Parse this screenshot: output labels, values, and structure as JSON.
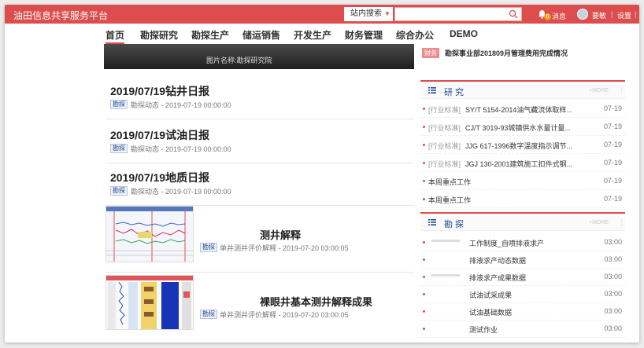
{
  "topbar": {
    "site_title": "油田信息共享服务平台",
    "search_scope": "站内搜索",
    "search_placeholder": "",
    "message_count": "0",
    "message_label": "消息",
    "username": "要敏",
    "settings_label": "设置",
    "separator": "|",
    "accent_color": "#de4d4d"
  },
  "nav": {
    "items": [
      "首页",
      "勘探研究",
      "勘探生产",
      "储运销售",
      "开发生产",
      "财务管理",
      "综合办公",
      "DEMO"
    ]
  },
  "banner": {
    "caption": "图片名称:勘探研究院"
  },
  "posts": [
    {
      "title": "2019/07/19钻井日报",
      "tag": "勘探",
      "meta": "勘探动态 - 2019-07-19 00:00:00"
    },
    {
      "title": "2019/07/19试油日报",
      "tag": "勘探",
      "meta": "勘探动态 - 2019-07-19 00:00:00"
    },
    {
      "title": "2019/07/19地质日报",
      "tag": "勘探",
      "meta": "勘探动态 - 2019-07-19 00:00:00"
    }
  ],
  "image_posts": [
    {
      "title": "测井解释",
      "tag": "勘探",
      "meta": "单井测井评价解释 - 2019-07-20 03:00:05"
    },
    {
      "title": "裸眼井基本测井解释成果",
      "tag": "勘探",
      "meta": "单井测井评价解释 - 2019-07-20 03:00:05"
    }
  ],
  "notice": {
    "badge": "财务",
    "text": "勘探事业部201809月管理费用完成情况"
  },
  "research_panel": {
    "title": "研 究",
    "more": "+MORE",
    "menu": "⋮",
    "rows": [
      {
        "category": "[行业标准]",
        "title": "SY/T 5154-2014油气藏流体取样...",
        "date": "07-19"
      },
      {
        "category": "[行业标准]",
        "title": "CJ/T 3019-93城镇供水水量计量...",
        "date": "07-19"
      },
      {
        "category": "[行业标准]",
        "title": "JJG 617-1996数字温度指示调节...",
        "date": "07-19"
      },
      {
        "category": "[行业标准]",
        "title": "JGJ 130-2001建筑施工扣件式钢...",
        "date": "07-19"
      },
      {
        "category": "",
        "title": "本周重点工作",
        "date": "07-19"
      },
      {
        "category": "",
        "title": "本周重点工作",
        "date": "07-19"
      }
    ]
  },
  "explore_panel": {
    "title": "勘 探",
    "more": "+MORE",
    "menu": "⋮",
    "rows": [
      {
        "title": "工作制度_自喷排液求产",
        "date": "03:00"
      },
      {
        "title": "排液求产动态数据",
        "date": "03:00"
      },
      {
        "title": "排液求产成果数据",
        "date": "03:00"
      },
      {
        "title": "试油试采成果",
        "date": "03:00"
      },
      {
        "title": "试油基础数据",
        "date": "03:00"
      },
      {
        "title": "测试作业",
        "date": "03:00"
      }
    ]
  }
}
